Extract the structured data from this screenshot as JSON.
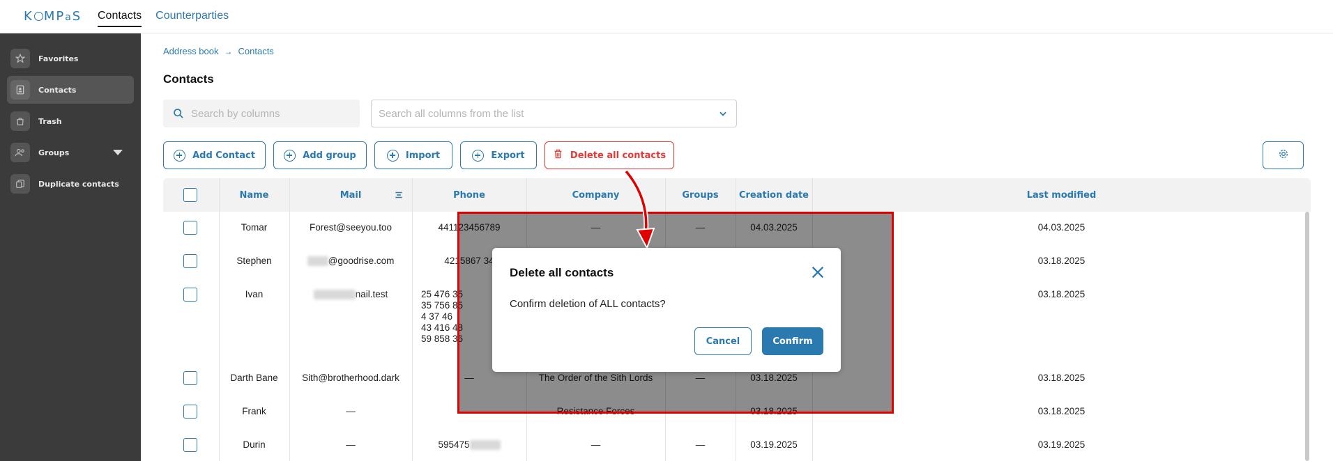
{
  "app": {
    "logo_text": "KOMPaS",
    "top_nav": [
      "Contacts",
      "Counterparties"
    ]
  },
  "sidebar": {
    "items": [
      {
        "label": "Favorites",
        "icon": "star-icon"
      },
      {
        "label": "Contacts",
        "icon": "address-book-icon",
        "active": true
      },
      {
        "label": "Trash",
        "icon": "trash-bag-icon"
      },
      {
        "label": "Groups",
        "icon": "users-icon",
        "expandable": true
      },
      {
        "label": "Duplicate contacts",
        "icon": "duplicate-icon"
      }
    ]
  },
  "breadcrumb": [
    "Address book",
    "Contacts"
  ],
  "page_title": "Contacts",
  "search": {
    "placeholder": "Search by columns",
    "columns_placeholder": "Search all columns from the list"
  },
  "toolbar": {
    "add_contact": "Add Contact",
    "add_group": "Add group",
    "import": "Import",
    "export": "Export",
    "delete_all": "Delete all contacts"
  },
  "table": {
    "headers": [
      "Name",
      "Mail",
      "Phone",
      "Company",
      "Groups",
      "Creation date",
      "Last modified"
    ],
    "rows": [
      {
        "name": "Tomar",
        "mail": "Forest@seeyou.too",
        "phone": "441123456789",
        "company": "—",
        "groups": "—",
        "created": "04.03.2025",
        "modified": "04.03.2025"
      },
      {
        "name": "Stephen",
        "mail": "@goodrise.com",
        "phone": "4215867 34",
        "company": "",
        "groups": "",
        "created": "",
        "modified": "03.18.2025"
      },
      {
        "name": "Ivan",
        "mail": "nail.test",
        "phone": "",
        "company": "",
        "groups": "",
        "created": "",
        "modified": "03.18.2025"
      },
      {
        "name": "Darth Bane",
        "mail": "Sith@brotherhood.dark",
        "phone": "—",
        "company": "The Order of the Sith Lords",
        "groups": "—",
        "created": "03.18.2025",
        "modified": "03.18.2025"
      },
      {
        "name": "Frank",
        "mail": "—",
        "phone": "—",
        "company": "Resistance Forces",
        "groups": "—",
        "created": "03.18.2025",
        "modified": "03.18.2025"
      },
      {
        "name": "Durin",
        "mail": "—",
        "phone": "595475",
        "company": "—",
        "groups": "—",
        "created": "03.19.2025",
        "modified": "03.19.2025"
      }
    ],
    "ivan_phones": [
      "25 476 35",
      "35 756 85",
      "4 37 46",
      "43 416 48",
      "59 858 36"
    ]
  },
  "dialog": {
    "title": "Delete all contacts",
    "message": "Confirm deletion of ALL contacts?",
    "cancel": "Cancel",
    "confirm": "Confirm"
  },
  "colors": {
    "accent": "#2a7ab0",
    "danger": "#e53935",
    "sidebar": "#3b3b3b"
  }
}
